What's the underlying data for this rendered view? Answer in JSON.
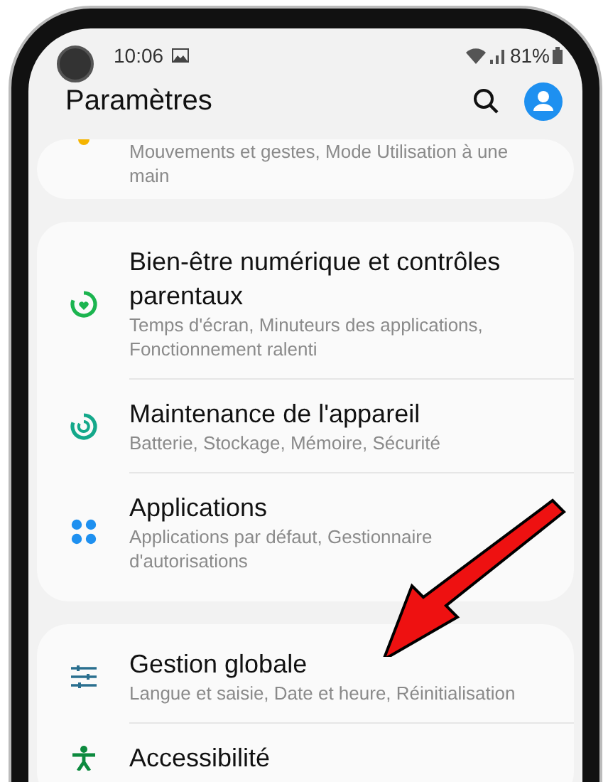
{
  "status_bar": {
    "time": "10:06",
    "battery": "81%"
  },
  "header": {
    "title": "Paramètres"
  },
  "groups": [
    {
      "items": [
        {
          "kind": "motion",
          "subtitle_lines": [
            "Mouvements et gestes, Mode Utilisation à une",
            "main"
          ]
        }
      ]
    },
    {
      "items": [
        {
          "kind": "wellbeing",
          "title_lines": [
            "Bien-être numérique et contrôles",
            "parentaux"
          ],
          "subtitle_lines": [
            "Temps d'écran, Minuteurs des applications,",
            "Fonctionnement ralenti"
          ]
        },
        {
          "kind": "maintenance",
          "title_lines": [
            "Maintenance de l'appareil"
          ],
          "subtitle_lines": [
            "Batterie, Stockage, Mémoire, Sécurité"
          ]
        },
        {
          "kind": "apps",
          "title_lines": [
            "Applications"
          ],
          "subtitle_lines": [
            "Applications par défaut, Gestionnaire",
            "d'autorisations"
          ]
        }
      ]
    },
    {
      "items": [
        {
          "kind": "general",
          "title_lines": [
            "Gestion globale"
          ],
          "subtitle_lines": [
            "Langue et saisie, Date et heure, Réinitialisation"
          ]
        },
        {
          "kind": "accessibility",
          "title_lines": [
            "Accessibilité"
          ]
        }
      ]
    }
  ]
}
